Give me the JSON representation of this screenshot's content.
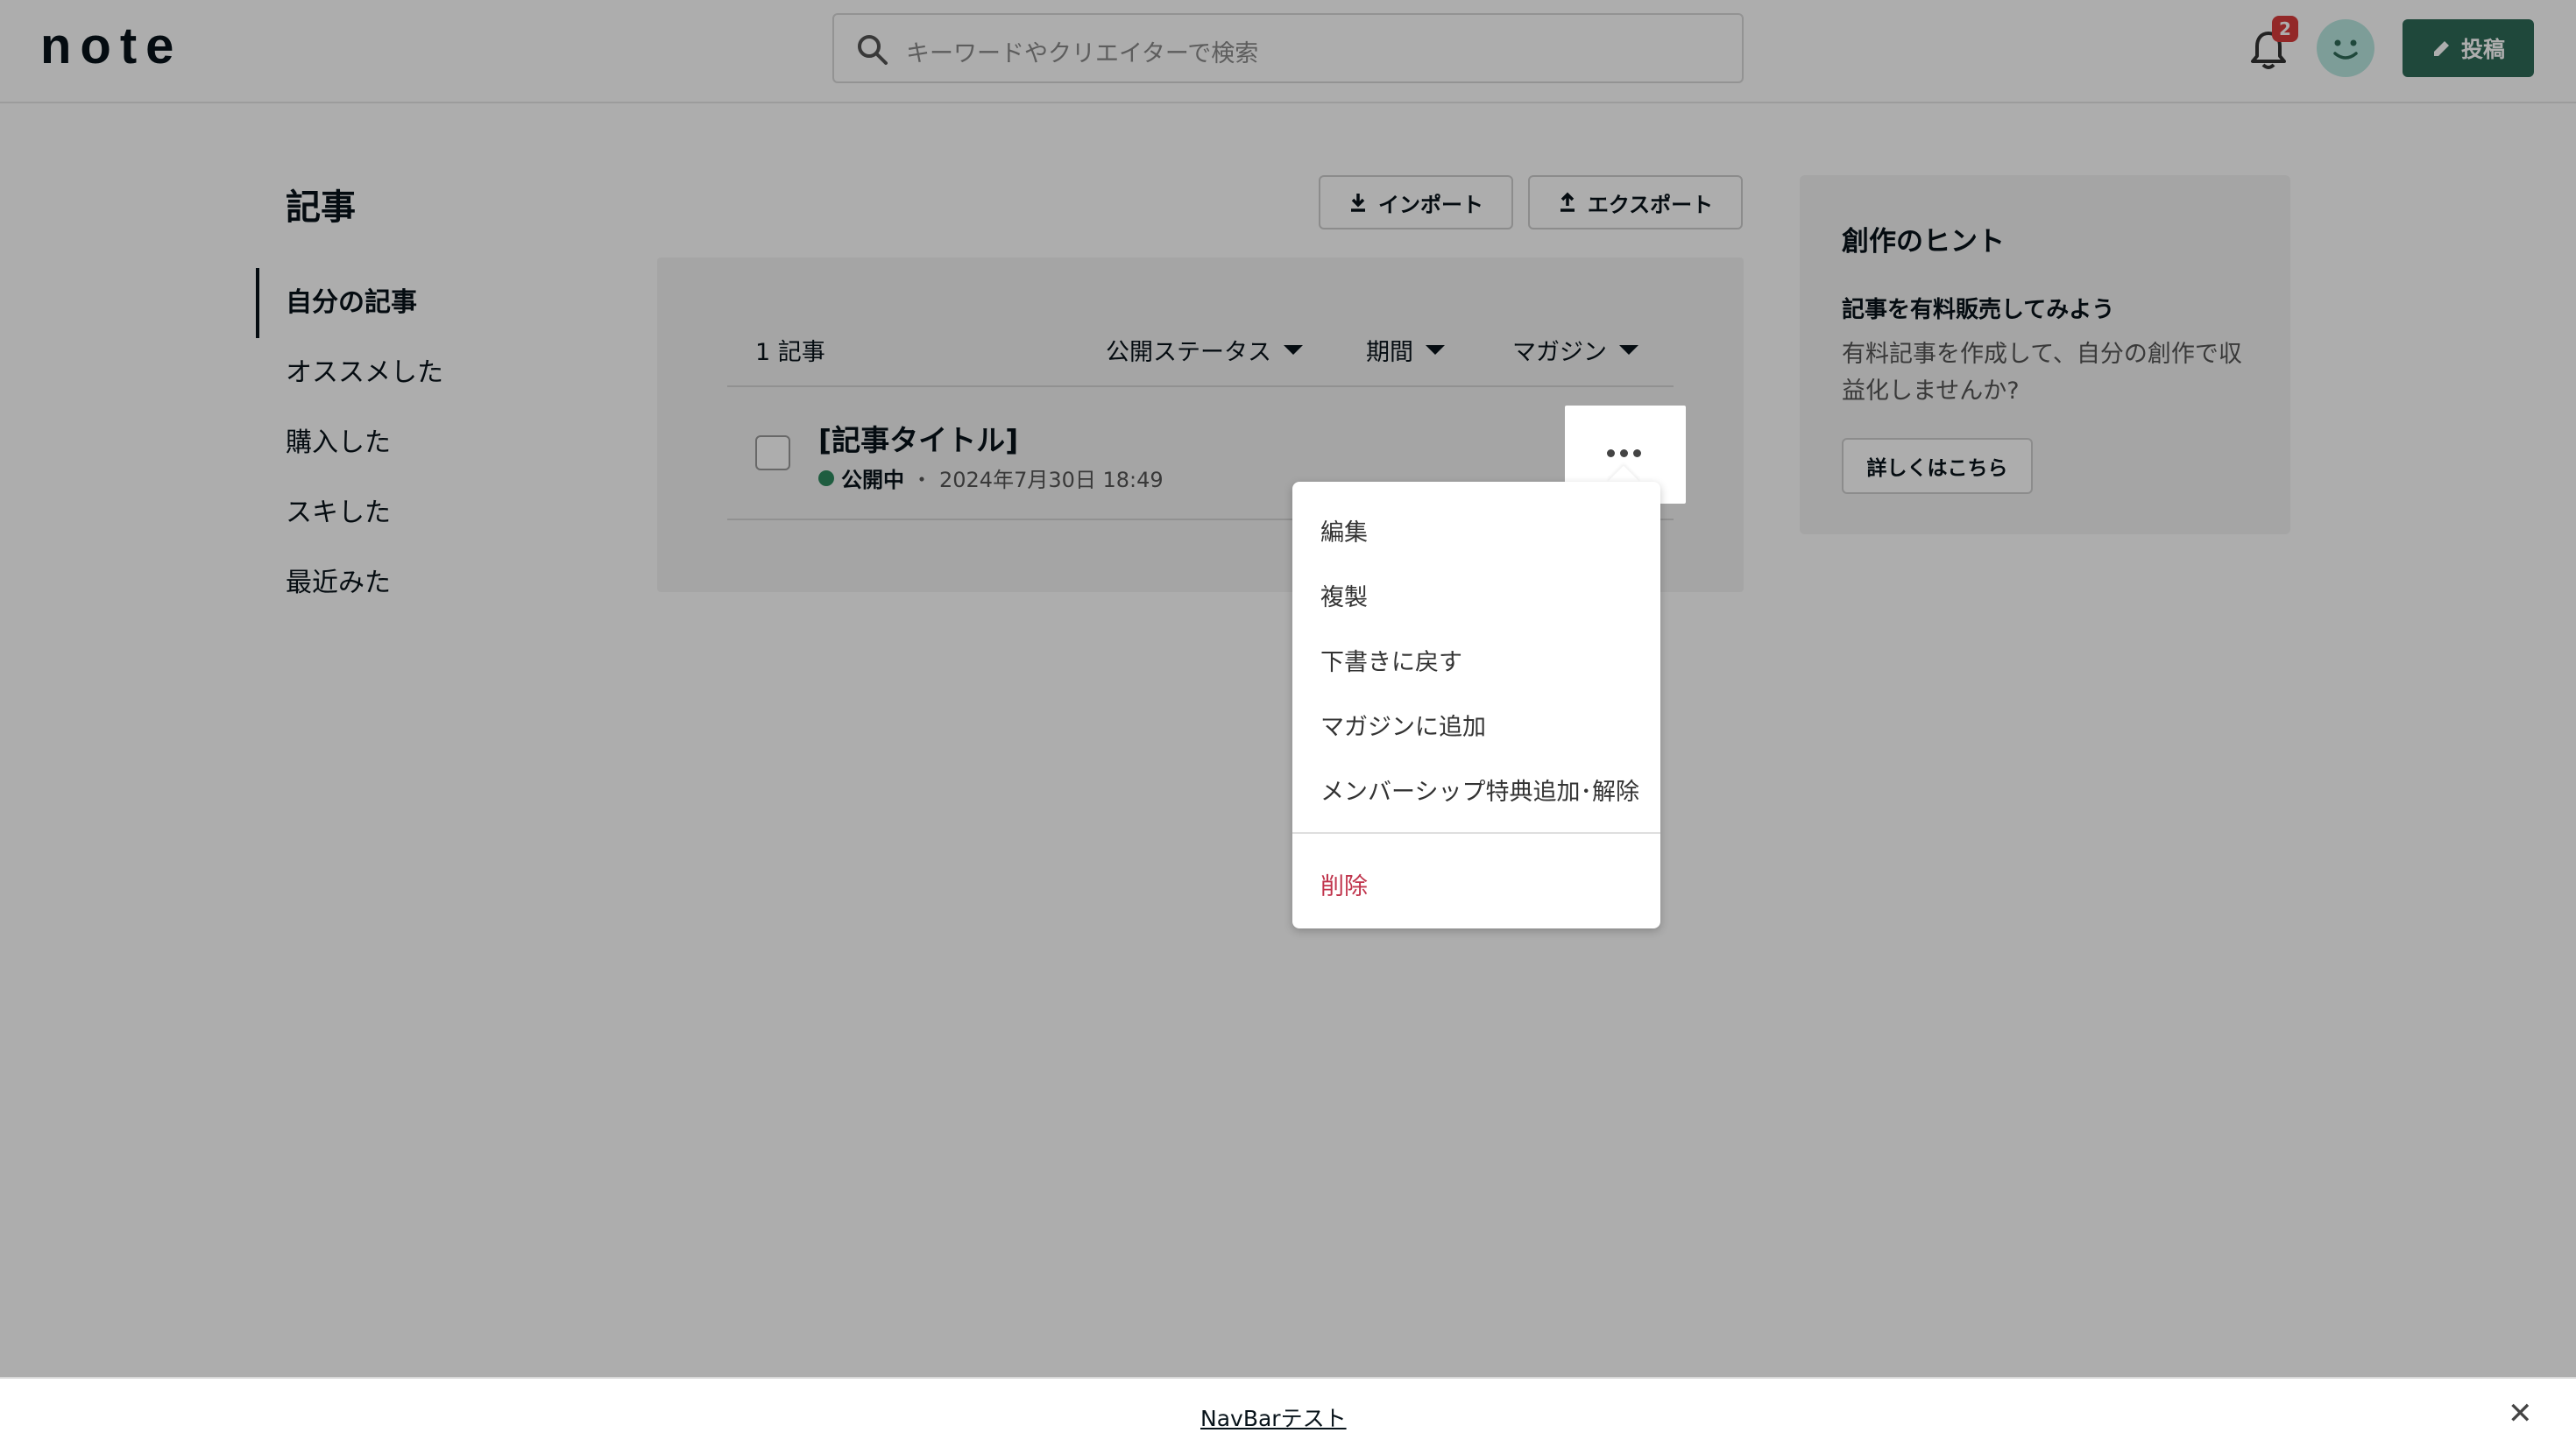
{
  "header": {
    "logo_text": "note",
    "search_placeholder": "キーワードやクリエイターで検索",
    "notification_count": "2",
    "post_label": "投稿"
  },
  "sidebar": {
    "title": "記事",
    "items": [
      {
        "label": "自分の記事",
        "active": true
      },
      {
        "label": "オススメした",
        "active": false
      },
      {
        "label": "購入した",
        "active": false
      },
      {
        "label": "スキした",
        "active": false
      },
      {
        "label": "最近みた",
        "active": false
      }
    ]
  },
  "toolbar": {
    "import_label": "インポート",
    "export_label": "エクスポート"
  },
  "list": {
    "count_label": "1 記事",
    "filters": [
      "公開ステータス",
      "期間",
      "マガジン"
    ],
    "articles": [
      {
        "title": "[記事タイトル]",
        "status": "公開中",
        "separator": "・",
        "date": "2024年7月30日 18:49"
      }
    ]
  },
  "menu": {
    "items": [
      "編集",
      "複製",
      "下書きに戻す",
      "マガジンに追加",
      "メンバーシップ特典追加･解除"
    ],
    "danger_item": "削除"
  },
  "hint": {
    "title": "創作のヒント",
    "subtitle": "記事を有料販売してみよう",
    "body": "有料記事を作成して、自分の創作で収益化しませんか?",
    "button_label": "詳しくはこちら"
  },
  "bottombar": {
    "link_label": "NavBarテスト",
    "close_glyph": "✕"
  },
  "colors": {
    "brand_green": "#2f6a58",
    "status_green": "#2f8a5f",
    "danger_red": "#c0344c",
    "badge_red": "#d93b3b"
  }
}
